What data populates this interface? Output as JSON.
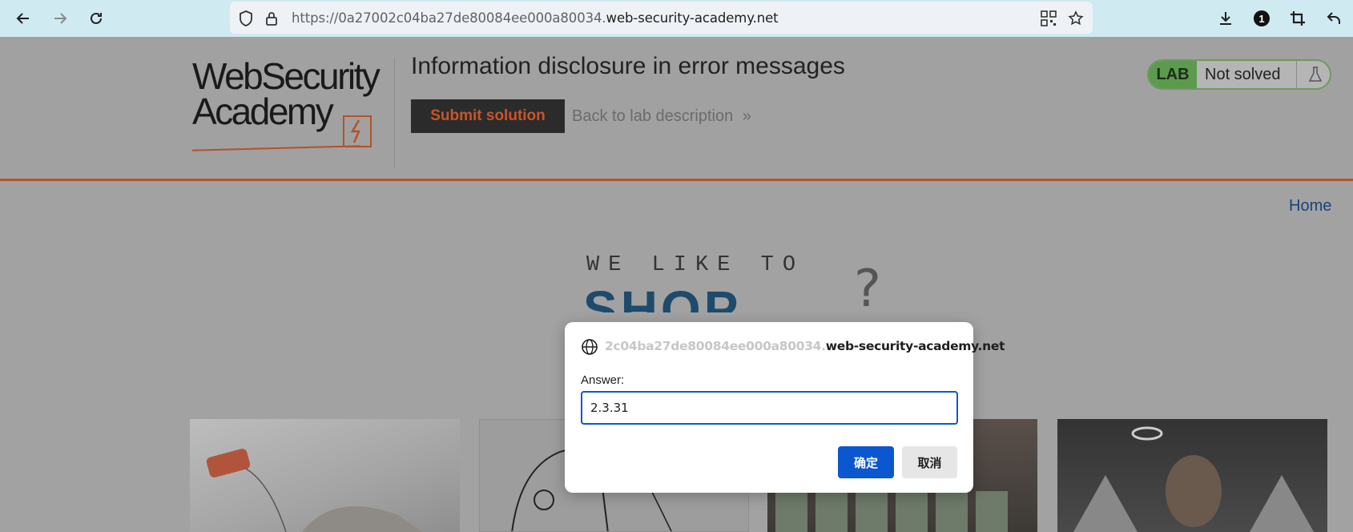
{
  "browser": {
    "url_prefix": "https://0a27002c04ba27de80084ee000a80034.",
    "url_host": "web-security-academy.net",
    "icons": [
      "back-arrow-icon",
      "forward-arrow-icon",
      "reload-icon",
      "shield-icon",
      "lock-icon",
      "qr-code-icon",
      "star-icon",
      "download-icon",
      "profile-badge-icon",
      "crop-icon",
      "undo-icon"
    ],
    "profile_badge": "1"
  },
  "lab": {
    "logo_line1": "WebSecurity",
    "logo_line2": "Academy",
    "title": "Information disclosure in error messages",
    "submit_label": "Submit solution",
    "back_label": "Back to lab description",
    "back_chevrons": "»",
    "badge": "LAB",
    "status": "Not solved"
  },
  "nav": {
    "home": "Home"
  },
  "hero": {
    "tagline": "WE LIKE TO",
    "big": "SHOP",
    "question": "?"
  },
  "dialog": {
    "origin_faded": "2c04ba27de80084ee000a80034.",
    "origin_host": "web-security-academy.net",
    "label": "Answer:",
    "value": "2.3.31",
    "ok_label": "确定",
    "cancel_label": "取消"
  },
  "colors": {
    "accent": "#b5512b",
    "primary_button": "#0b57d0",
    "lab_green": "#5a9b4e",
    "link": "#15467a"
  }
}
